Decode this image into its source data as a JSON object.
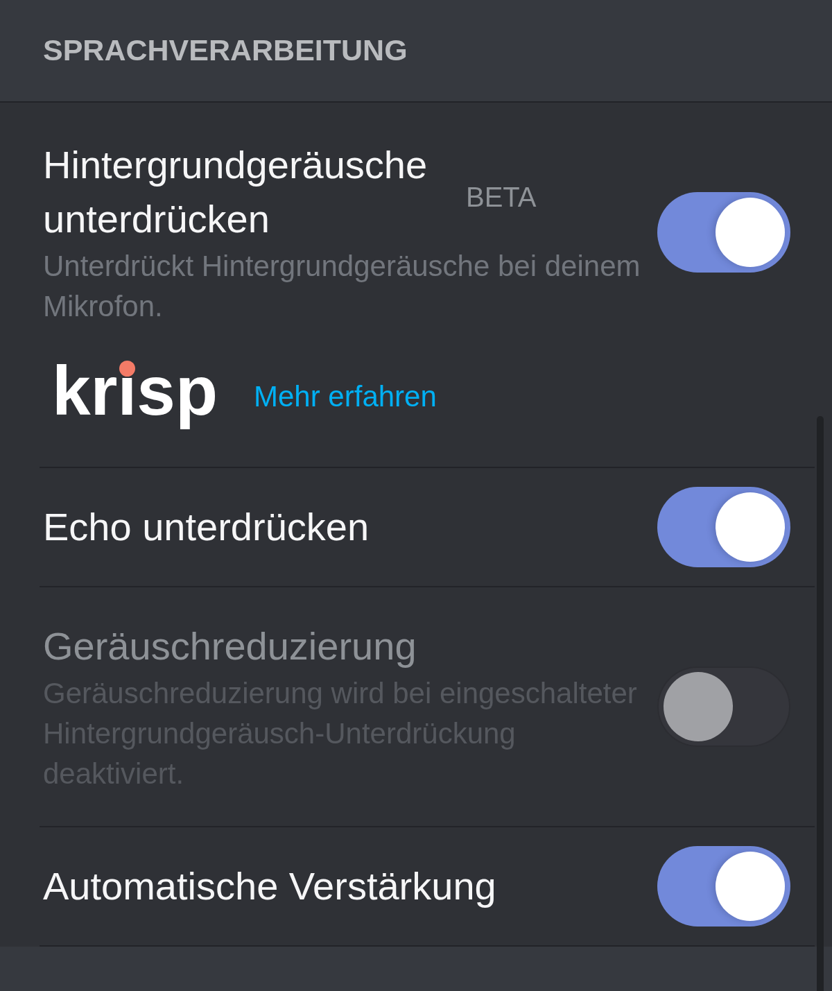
{
  "section_title": "SPRACHVERARBEITUNG",
  "settings": [
    {
      "title": "Hintergrundgeräusche unterdrücken",
      "badge": "BETA",
      "description": "Unterdrückt Hintergrundgeräusche bei deinem Mikrofon.",
      "on": true,
      "disabled": false,
      "logo": {
        "text": "krisp"
      },
      "link": "Mehr erfahren"
    },
    {
      "title": "Echo unterdrücken",
      "on": true,
      "disabled": false
    },
    {
      "title": "Geräuschreduzierung",
      "description": "Geräuschreduzierung wird bei eingeschalteter Hintergrundgeräusch-Unterdrückung deaktiviert.",
      "on": false,
      "disabled": true
    },
    {
      "title": "Automatische Verstärkung",
      "on": true,
      "disabled": false
    }
  ]
}
